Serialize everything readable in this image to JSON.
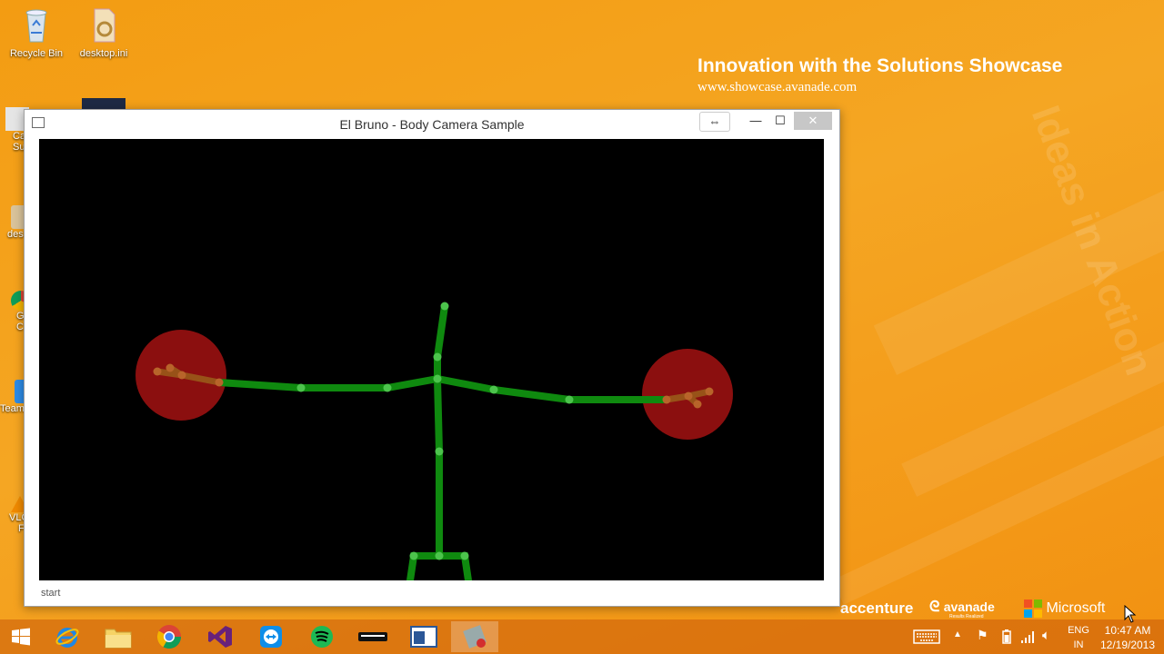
{
  "desktop": {
    "icons": [
      {
        "label": "Recycle Bin",
        "icon": "recycle-bin-icon"
      },
      {
        "label": "desktop.ini",
        "icon": "settings-file-icon"
      }
    ],
    "partial_labels": [
      "Ca",
      "Su",
      "des",
      "G",
      "C",
      "Team",
      "VLC",
      "F"
    ]
  },
  "wallpaper": {
    "headline": "Innovation with the Solutions Showcase",
    "url": "www.showcase.avanade.com",
    "watermark": "Ideas in Action",
    "brands": [
      "accenture",
      "avanade",
      "Results Realized",
      "Microsoft"
    ]
  },
  "window": {
    "title": "El Bruno - Body Camera Sample",
    "status": "start",
    "buttons": {
      "restore": "⇔",
      "minimize": "—",
      "maximize": "☐",
      "close": "✕"
    }
  },
  "colors": {
    "skeleton_green": "#0f8a0f",
    "joint_green": "#4cc44c",
    "hand_red": "#8b0f0f",
    "wallpaper_orange": "#f5a623"
  },
  "taskbar": {
    "apps": [
      "internet-explorer",
      "file-explorer",
      "chrome",
      "visual-studio",
      "teamviewer",
      "spotify",
      "keyboard-app",
      "window-app",
      "kinect-studio"
    ],
    "tray": {
      "lang_top": "ENG",
      "lang_bottom": "IN",
      "time": "10:47 AM",
      "date": "12/19/2013"
    }
  }
}
